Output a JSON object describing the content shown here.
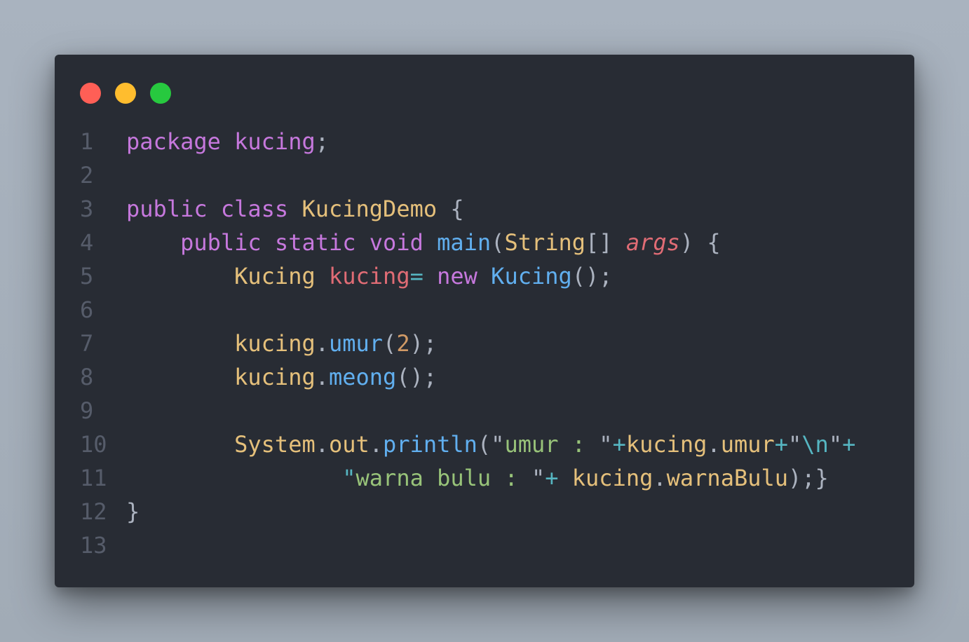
{
  "window": {
    "controls": {
      "close_color": "#ff5f56",
      "minimize_color": "#ffbd2e",
      "maximize_color": "#27c93f"
    }
  },
  "editor": {
    "language": "java",
    "lines": [
      {
        "number": "1",
        "tokens": [
          {
            "t": "package",
            "c": "kw"
          },
          {
            "t": " ",
            "c": "punc"
          },
          {
            "t": "kucing",
            "c": "kw"
          },
          {
            "t": ";",
            "c": "punc"
          }
        ]
      },
      {
        "number": "2",
        "tokens": []
      },
      {
        "number": "3",
        "tokens": [
          {
            "t": "public",
            "c": "kw"
          },
          {
            "t": " ",
            "c": "punc"
          },
          {
            "t": "class",
            "c": "kw"
          },
          {
            "t": " ",
            "c": "punc"
          },
          {
            "t": "KucingDemo",
            "c": "typ"
          },
          {
            "t": " {",
            "c": "punc"
          }
        ]
      },
      {
        "number": "4",
        "tokens": [
          {
            "t": "    ",
            "c": "punc"
          },
          {
            "t": "public",
            "c": "kw"
          },
          {
            "t": " ",
            "c": "punc"
          },
          {
            "t": "static",
            "c": "kw"
          },
          {
            "t": " ",
            "c": "punc"
          },
          {
            "t": "void",
            "c": "kw"
          },
          {
            "t": " ",
            "c": "punc"
          },
          {
            "t": "main",
            "c": "fn"
          },
          {
            "t": "(",
            "c": "punc"
          },
          {
            "t": "String",
            "c": "typ"
          },
          {
            "t": "[] ",
            "c": "punc"
          },
          {
            "t": "args",
            "c": "param"
          },
          {
            "t": ") {",
            "c": "punc"
          }
        ]
      },
      {
        "number": "5",
        "tokens": [
          {
            "t": "        ",
            "c": "punc"
          },
          {
            "t": "Kucing",
            "c": "typ"
          },
          {
            "t": " ",
            "c": "punc"
          },
          {
            "t": "kucing",
            "c": "var"
          },
          {
            "t": "=",
            "c": "op"
          },
          {
            "t": " ",
            "c": "punc"
          },
          {
            "t": "new",
            "c": "kw"
          },
          {
            "t": " ",
            "c": "punc"
          },
          {
            "t": "Kucing",
            "c": "fn"
          },
          {
            "t": "();",
            "c": "punc"
          }
        ]
      },
      {
        "number": "6",
        "tokens": []
      },
      {
        "number": "7",
        "tokens": [
          {
            "t": "        ",
            "c": "punc"
          },
          {
            "t": "kucing",
            "c": "typ"
          },
          {
            "t": ".",
            "c": "punc"
          },
          {
            "t": "umur",
            "c": "fn"
          },
          {
            "t": "(",
            "c": "punc"
          },
          {
            "t": "2",
            "c": "num"
          },
          {
            "t": ");",
            "c": "punc"
          }
        ]
      },
      {
        "number": "8",
        "tokens": [
          {
            "t": "        ",
            "c": "punc"
          },
          {
            "t": "kucing",
            "c": "typ"
          },
          {
            "t": ".",
            "c": "punc"
          },
          {
            "t": "meong",
            "c": "fn"
          },
          {
            "t": "();",
            "c": "punc"
          }
        ]
      },
      {
        "number": "9",
        "tokens": []
      },
      {
        "number": "10",
        "tokens": [
          {
            "t": "        ",
            "c": "punc"
          },
          {
            "t": "System",
            "c": "typ"
          },
          {
            "t": ".",
            "c": "punc"
          },
          {
            "t": "out",
            "c": "typ"
          },
          {
            "t": ".",
            "c": "punc"
          },
          {
            "t": "println",
            "c": "fn"
          },
          {
            "t": "(\"",
            "c": "punc"
          },
          {
            "t": "umur : ",
            "c": "str"
          },
          {
            "t": "\"",
            "c": "punc"
          },
          {
            "t": "+",
            "c": "op"
          },
          {
            "t": "kucing",
            "c": "typ"
          },
          {
            "t": ".",
            "c": "punc"
          },
          {
            "t": "umur",
            "c": "typ"
          },
          {
            "t": "+",
            "c": "op"
          },
          {
            "t": "\"",
            "c": "punc"
          },
          {
            "t": "\\n",
            "c": "esc"
          },
          {
            "t": "\"",
            "c": "punc"
          },
          {
            "t": "+",
            "c": "op"
          }
        ]
      },
      {
        "number": "11",
        "tokens": [
          {
            "t": "                ",
            "c": "punc"
          },
          {
            "t": "\"",
            "c": "esc"
          },
          {
            "t": "warna bulu : ",
            "c": "str"
          },
          {
            "t": "\"",
            "c": "punc"
          },
          {
            "t": "+",
            "c": "op"
          },
          {
            "t": " ",
            "c": "punc"
          },
          {
            "t": "kucing",
            "c": "typ"
          },
          {
            "t": ".",
            "c": "punc"
          },
          {
            "t": "warnaBulu",
            "c": "typ"
          },
          {
            "t": ");}",
            "c": "punc"
          }
        ]
      },
      {
        "number": "12",
        "tokens": [
          {
            "t": "}",
            "c": "punc"
          }
        ]
      },
      {
        "number": "13",
        "tokens": []
      }
    ]
  }
}
